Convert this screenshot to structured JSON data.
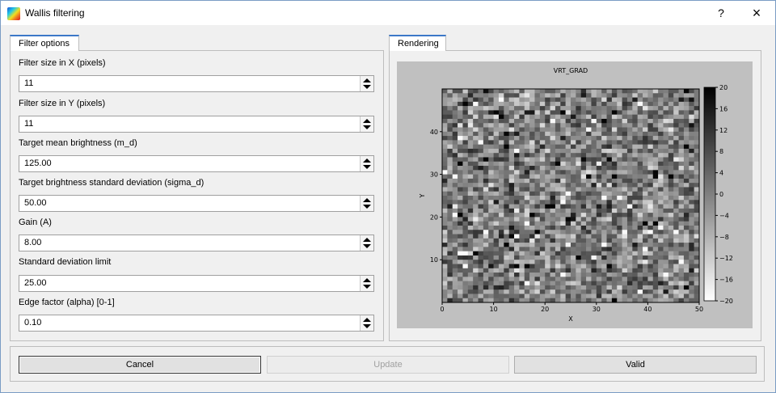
{
  "window": {
    "title": "Wallis filtering",
    "help_label": "?",
    "close_label": "×"
  },
  "tabs": {
    "filter": "Filter options",
    "rendering": "Rendering"
  },
  "fields": [
    {
      "label": "Filter size in X (pixels)",
      "value": "11"
    },
    {
      "label": "Filter size in Y (pixels)",
      "value": "11"
    },
    {
      "label": "Target mean brightness (m_d)",
      "value": "125.00"
    },
    {
      "label": "Target brightness standard deviation (sigma_d)",
      "value": "50.00"
    },
    {
      "label": "Gain (A)",
      "value": "8.00"
    },
    {
      "label": "Standard deviation limit",
      "value": "25.00"
    },
    {
      "label": "Edge factor (alpha) [0-1]",
      "value": "0.10"
    }
  ],
  "buttons": {
    "cancel": "Cancel",
    "update": "Update",
    "valid": "Valid"
  },
  "chart_data": {
    "type": "heatmap",
    "title": "VRT_GRAD",
    "xlabel": "X",
    "ylabel": "Y",
    "xlim": [
      0,
      50
    ],
    "ylim": [
      0,
      50
    ],
    "x_ticks": [
      "0",
      "10",
      "20",
      "30",
      "40",
      "50"
    ],
    "y_ticks": [
      "10",
      "20",
      "30",
      "40"
    ],
    "colorbar": {
      "min": -20,
      "max": 20,
      "ticks": [
        "20",
        "16",
        "12",
        "8",
        "4",
        "0",
        "−4",
        "−8",
        "−12",
        "−16",
        "−20"
      ],
      "colors": [
        "#ffffff",
        "#000000"
      ]
    }
  }
}
